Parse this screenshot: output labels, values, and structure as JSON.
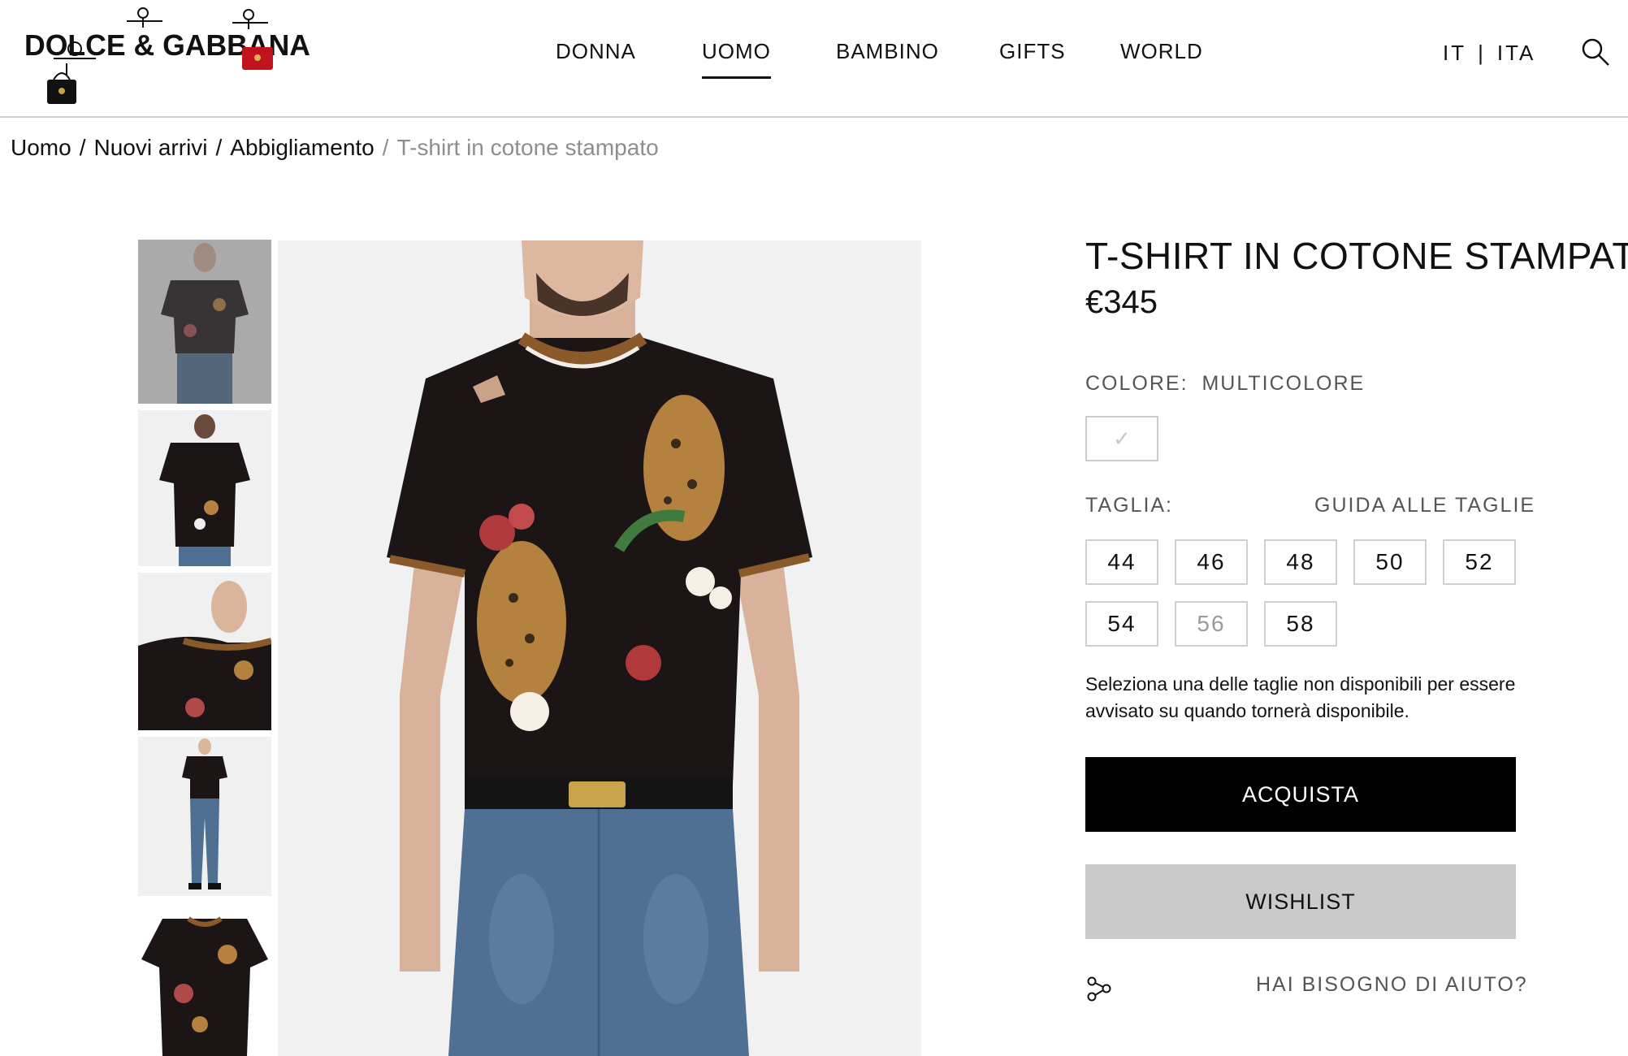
{
  "brand": {
    "logo_text": "DOLCE & GABBANA"
  },
  "nav": {
    "items": [
      {
        "label": "DONNA"
      },
      {
        "label": "UOMO",
        "active": true
      },
      {
        "label": "BAMBINO"
      },
      {
        "label": "GIFTS"
      },
      {
        "label": "WORLD"
      }
    ]
  },
  "language": {
    "country": "IT",
    "separator": "|",
    "language": "ITA"
  },
  "icons": {
    "search": "search-icon",
    "share": "share-icon",
    "checkmark": "check-icon"
  },
  "breadcrumb": {
    "items": [
      "Uomo",
      "Nuovi arrivi",
      "Abbigliamento"
    ],
    "separator": "/",
    "current": "T-shirt in cotone stampato"
  },
  "gallery": {
    "thumbnail_count": 5,
    "selected_index": 0
  },
  "product": {
    "title": "T-SHIRT IN COTONE STAMPATO",
    "price": "€345",
    "color_label": "COLORE:",
    "color_value": "MULTICOLORE",
    "size_label": "TAGLIA:",
    "size_guide_label": "GUIDA ALLE TAGLIE",
    "sizes": [
      {
        "value": "44",
        "available": true
      },
      {
        "value": "46",
        "available": true
      },
      {
        "value": "48",
        "available": true
      },
      {
        "value": "50",
        "available": true
      },
      {
        "value": "52",
        "available": true
      },
      {
        "value": "54",
        "available": true
      },
      {
        "value": "56",
        "available": false
      },
      {
        "value": "58",
        "available": true
      }
    ],
    "availability_note": "Seleziona una delle taglie non disponibili per essere avvisato su quando tornerà disponibile.",
    "buy_label": "ACQUISTA",
    "wishlist_label": "WISHLIST",
    "help_label": "HAI BISOGNO DI AIUTO?"
  },
  "colors": {
    "buy_button_bg": "#000000",
    "wishlist_button_bg": "#cacaca",
    "shirt": "#1c1516",
    "collar_brown": "#8a5a2a",
    "denim": "#4f6f93"
  }
}
